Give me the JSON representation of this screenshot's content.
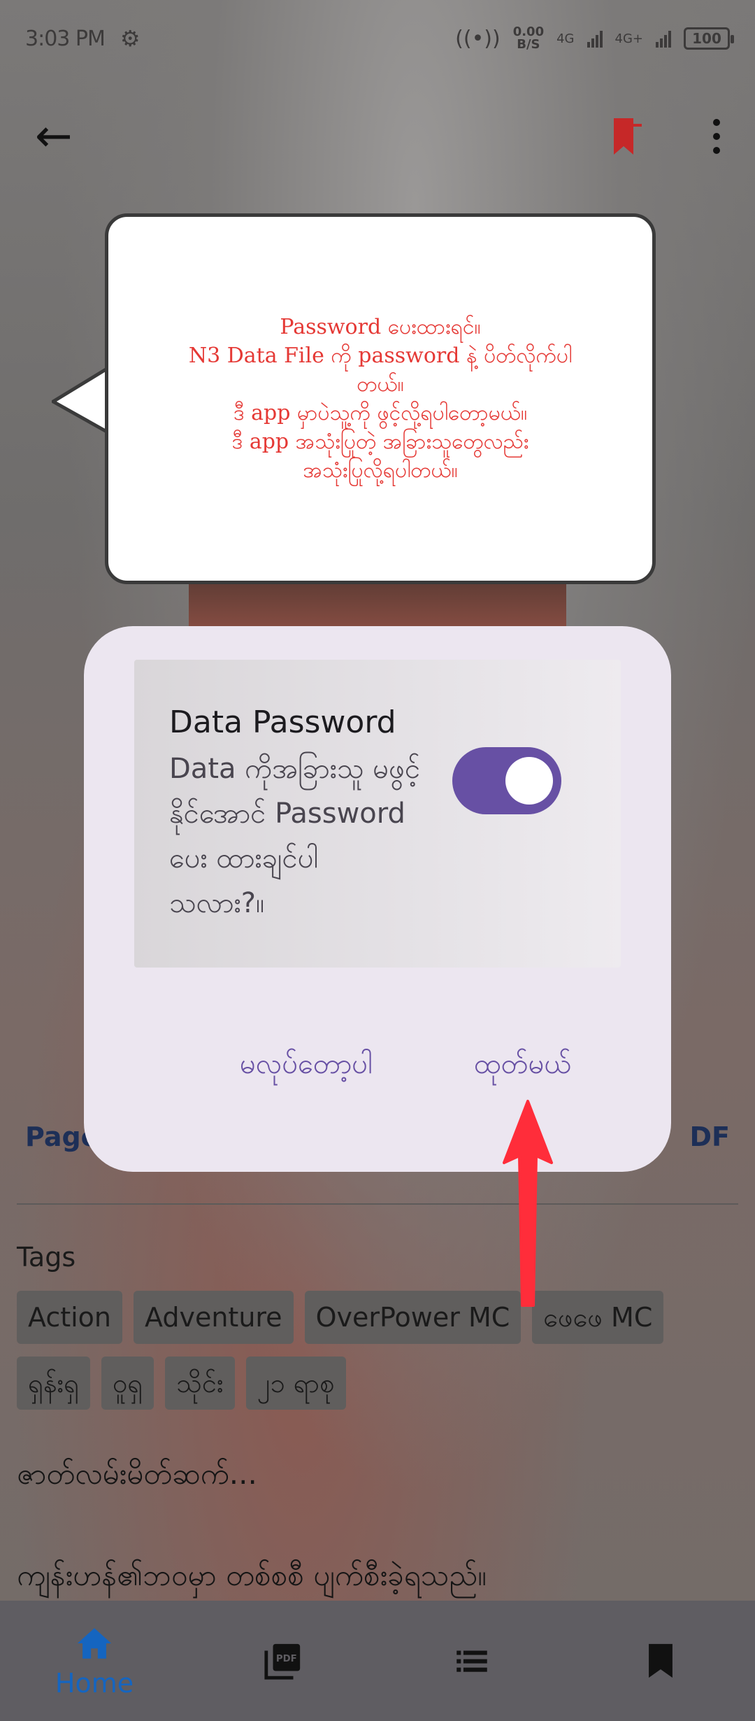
{
  "status_bar": {
    "time": "3:03 PM",
    "net_speed_value": "0.00",
    "net_speed_unit": "B/S",
    "sim1": "4G",
    "sim2": "4G+",
    "battery": "100"
  },
  "meta": {
    "left": "Page",
    "right": "DF"
  },
  "tags_title": "Tags",
  "tags": [
    "Action",
    "Adventure",
    "OverPower MC",
    "ဖေဖေ MC",
    "ရှန်းရှ",
    "ဝူရှ",
    "သိုင်း",
    "၂၁ ရာစု"
  ],
  "description": {
    "line1": "ဇာတ်လမ်းမိတ်ဆက်...",
    "line2": "ကျန်းဟန်၏ဘဝမှာ တစ်စစီ ပျက်စီးခဲ့ရသည်။"
  },
  "tooltip": {
    "line1": "Password ပေးထားရင်။",
    "line2": "N3 Data File ကို password နဲ့ ပိတ်လိုက်ပါ",
    "line3": "တယ်။",
    "line4": "ဒီ app မှာပဲသူ့ကို ဖွင့်လို့ရပါတော့မယ်။",
    "line5": "ဒီ app အသုံးပြုတဲ့ အခြားသူတွေလည်း",
    "line6": "အသုံးပြုလို့ရပါတယ်။",
    "color": "#e53935"
  },
  "dialog": {
    "title": "Data Password",
    "subtitle": "Data ကိုအခြားသူ မဖွင့်နိုင်အောင် Password ပေး ထားချင်ပါ သလား?။",
    "toggle_on": true,
    "cancel_label": "မလုပ်တော့ပါ",
    "ok_label": "ထုတ်မယ်",
    "accent": "#6750a4"
  },
  "bottom_nav": {
    "items": [
      {
        "icon": "home-icon",
        "label": "Home",
        "active": true
      },
      {
        "icon": "pdf-icon",
        "label": ""
      },
      {
        "icon": "list-icon",
        "label": ""
      },
      {
        "icon": "bookmark-icon",
        "label": ""
      }
    ]
  },
  "annotation": {
    "arrow_color": "#ff2d3a"
  }
}
